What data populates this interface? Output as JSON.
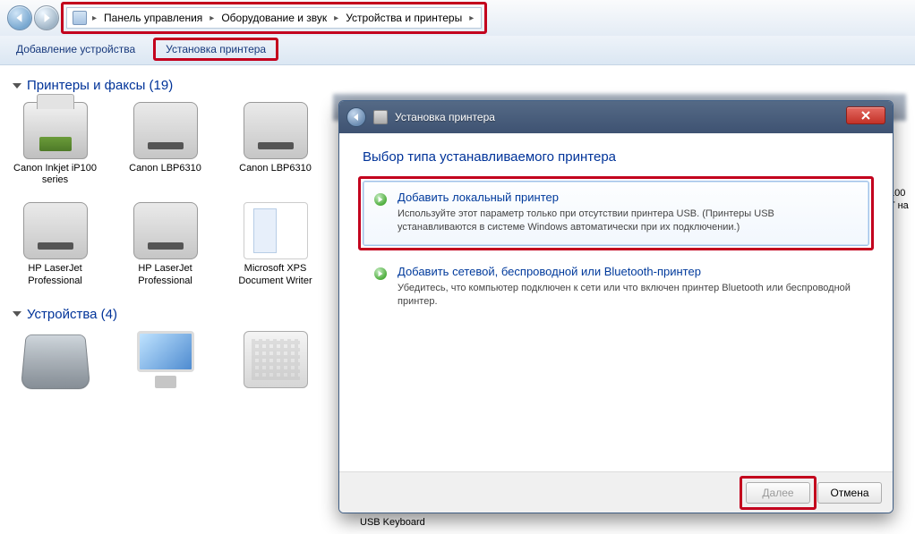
{
  "breadcrumb": [
    "Панель управления",
    "Оборудование и звук",
    "Устройства и принтеры"
  ],
  "toolbar": {
    "add_device": "Добавление устройства",
    "add_printer": "Установка принтера"
  },
  "groups": {
    "printers": {
      "title": "Принтеры и факсы",
      "count": 19
    },
    "devices": {
      "title": "Устройства",
      "count": 4
    }
  },
  "printers": [
    {
      "name": "Canon Inkjet iP100 series",
      "kind": "printer"
    },
    {
      "name": "Canon LBP6310",
      "kind": "laser"
    },
    {
      "name": "Canon LBP6310",
      "kind": "laser"
    },
    {
      "name": "HP LaserJet Professional",
      "kind": "laser"
    },
    {
      "name": "HP LaserJet Professional",
      "kind": "laser"
    },
    {
      "name": "Microsoft XPS Document Writer",
      "kind": "xps"
    }
  ],
  "devices": [
    {
      "name": "",
      "kind": "scanner"
    },
    {
      "name": "",
      "kind": "monitor"
    },
    {
      "name": "",
      "kind": "keyboard"
    }
  ],
  "behind_fragment_1": "100",
  "behind_fragment_2": "T на",
  "behind_label": "USB Keyboard",
  "dialog": {
    "title": "Установка принтера",
    "heading": "Выбор типа устанавливаемого принтера",
    "opt1_title": "Добавить локальный принтер",
    "opt1_desc": "Используйте этот параметр только при отсутствии принтера USB. (Принтеры USB устанавливаются в системе Windows автоматически при их подключении.)",
    "opt2_title": "Добавить сетевой, беспроводной или Bluetooth-принтер",
    "opt2_desc": "Убедитесь, что компьютер подключен к сети или что включен принтер Bluetooth или беспроводной принтер.",
    "next": "Далее",
    "cancel": "Отмена"
  }
}
